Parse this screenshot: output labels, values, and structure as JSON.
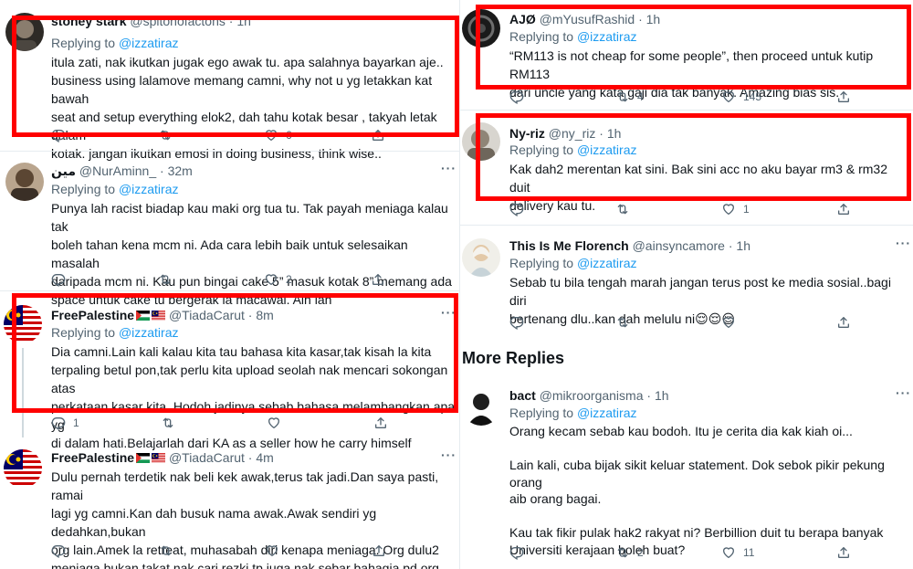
{
  "reply_label": "Replying to",
  "mention": "@izzatiraz",
  "more_replies_heading": "More Replies",
  "left_tweets": [
    {
      "name": "stoney stark",
      "handle": "@spitonofactons",
      "time": "1h",
      "body": "itula zati, nak ikutkan jugak ego awak tu. apa salahnya bayarkan aje..\nbusiness using lalamove memang camni, why not u yg letakkan kat bawah\nseat and setup everything elok2, dah tahu kotak besar , takyah letak dalam\nkotak. jangan ikutkan emosi in doing business, think wise..",
      "replies": "",
      "retweets": "",
      "likes": "6"
    },
    {
      "name": "مين",
      "handle": "@NurAminn_",
      "time": "32m",
      "body": "Punya lah racist biadap kau maki org tua tu. Tak payah meniaga kalau tak\nboleh tahan kena mcm ni. Ada cara lebih baik untuk selesaikan masalah\ndaripada mcm ni. Kau pun bingai cake 5” masuk kotak 8” memang ada\nspace untuk cake tu bergerak la macawai. Aih lah",
      "replies": "",
      "retweets": "",
      "likes": "2"
    },
    {
      "name": "FreePalestine",
      "handle": "@TiadaCarut",
      "time": "8m",
      "body": "Dia camni.Lain kali kalau kita tau bahasa kita kasar,tak kisah la kita\nterpaling betul pon,tak perlu kita upload seolah nak mencari sokongan atas\nperkataan kasar kita. Hodoh jadinya sebab bahasa melambangkan apa yg\ndi dalam hati.Belajarlah dari KA as a seller how he carry himself",
      "replies": "1",
      "retweets": "",
      "likes": ""
    },
    {
      "name": "FreePalestine",
      "handle": "@TiadaCarut",
      "time": "4m",
      "body": "Dulu pernah terdetik nak beli kek awak,terus tak jadi.Dan saya pasti, ramai\nlagi yg camni.Kan dah busuk nama awak.Awak sendiri yg dedahkan,bukan\norg lain.Amek la retreat, muhasabah diri kenapa meniaga. Org dulu2\nmeniaga bukan takat nak cari rezki,tp juga nak sebar bahagia pd org",
      "replies": "",
      "retweets": "",
      "likes": ""
    }
  ],
  "right_tweets": [
    {
      "name": "AJØ",
      "handle": "@mYusufRashid",
      "time": "1h",
      "body": "“RM113 is not cheap for some people”, then proceed untuk kutip RM113\ndari uncle yang kata gaji dia tak banyak. Amazing bias sis.",
      "replies": "",
      "retweets": "4",
      "likes": "145"
    },
    {
      "name": "Ny-riz",
      "handle": "@ny_riz",
      "time": "1h",
      "body": "Kak dah2 merentan kat sini. Bak sini acc no aku bayar rm3 & rm32 duit\ndelivery kau tu.",
      "replies": "",
      "retweets": "",
      "likes": "1"
    },
    {
      "name": "This Is Me Florench",
      "handle": "@ainsyncamore",
      "time": "1h",
      "body": "Sebab tu bila tengah marah jangan terus post ke media sosial..bagi diri\nbertenang dlu..kan dah melulu ni😌😌😌",
      "replies": "",
      "retweets": "",
      "likes": ""
    },
    {
      "name": "bact",
      "handle": "@mikroorganisma",
      "time": "1h",
      "body": "Orang kecam sebab kau bodoh. Itu je cerita dia kak kiah oi...\n\nLain kali, cuba bijak sikit keluar statement. Dok sebok pikir pekung orang\naib orang bagai.\n\nKau tak fikir pulak hak2 rakyat ni? Berbillion duit tu berapa banyak\nUniversiti kerajaan boleh buat?",
      "replies": "",
      "retweets": "2",
      "likes": "11"
    }
  ],
  "colors": {
    "highlight_box": "#ff0000",
    "link": "#1d9bf0",
    "muted": "#536471",
    "text": "#0f1419"
  },
  "icons": [
    "reply-icon",
    "retweet-icon",
    "like-icon",
    "share-icon",
    "more-icon",
    "palestine-flag-icon",
    "malaysia-flag-icon"
  ]
}
